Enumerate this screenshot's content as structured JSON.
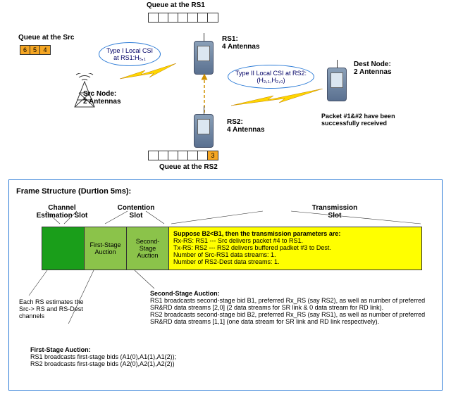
{
  "top": {
    "queue_src_label": "Queue at the Src",
    "queue_rs1_label": "Queue at the RS1",
    "queue_rs2_label": "Queue at the RS2",
    "src_node_label": "Src Node:\n2 Antennas",
    "rs1_label": "RS1:\n4 Antennas",
    "rs2_label": "RS2:\n4 Antennas",
    "dest_label": "Dest Node:\n2 Antennas",
    "csi1": "Type I Local CSI\nat RS1:H₅,₁",
    "csi2": "Type II Local CSI at RS2:\n(H₂,₁,H₂,₀)",
    "dest_note": "Packet #1&#2 have been\nsuccessfully received",
    "queue_src_cells": [
      "6",
      "5",
      "4"
    ],
    "queue_rs1_len": 7,
    "queue_rs2_len": 7,
    "queue_rs2_value": "3"
  },
  "frame": {
    "title": "Frame Structure (Durtion 5ms):",
    "headers": {
      "est": "Channel\nEstimation Slot",
      "cont": "Contention\nSlot",
      "trans": "Transmission\nSlot"
    },
    "slots": {
      "first_stage": "First-Stage\nAuction",
      "second_stage": "Second-\nStage\nAuction"
    },
    "trans_box": {
      "headline": "Suppose B2<B1, then the transmission parameters are:",
      "l1": "Rx-RS: RS1 --- Src delivers packet #4 to RS1.",
      "l2": "Tx-RS: RS2 --- RS2 delivers buffered padket #3 to Dest.",
      "l3": "Number of Src-RS1 data streams: 1.",
      "l4": "Number of RS2-Dest data streams: 1."
    },
    "est_desc": "Each RS estimates the\nSrc-> RS and RS-Dest\nchannels",
    "first_stage_desc_head": "First-Stage Auction:",
    "first_stage_desc_body": "RS1 broadcasts first-stage bids (A1(0),A1(1),A1(2));\nRS2 broadcasts first-stage bids (A2(0),A2(1),A2(2))",
    "second_stage_desc_head": "Second-Stage Auction:",
    "second_stage_desc_body": "RS1 broadcasts second-stage bid B1, preferred Rx_RS (say RS2), as well as number of preferred\nSR&RD data streams [2,0] (2 data streams for SR link & 0 data stream for RD link).\nRS2 broadcasts second-stage bid B2, preferred Rx_RS (say RS1), as well as number of preferred\nSR&RD data streams [1,1] (one data stream for SR link and RD link respectively)."
  }
}
